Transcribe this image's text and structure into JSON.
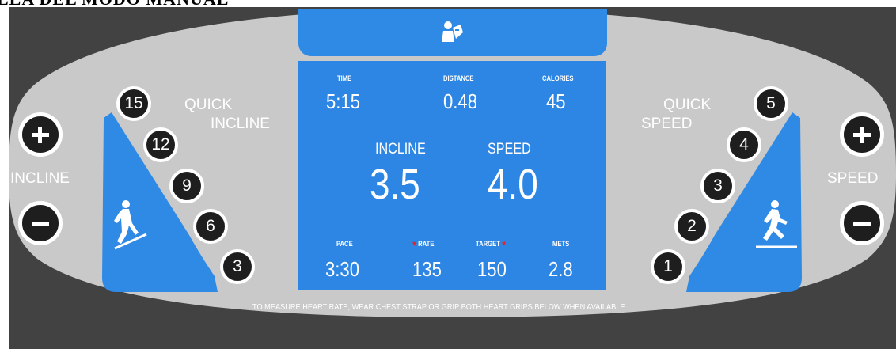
{
  "caption": "LLA DEL MODO MANUAL",
  "incline_controls": {
    "label": "INCLINE",
    "quick_label_1": "QUICK",
    "quick_label_2": "INCLINE",
    "quick_buttons": [
      "15",
      "12",
      "9",
      "6",
      "3"
    ]
  },
  "speed_controls": {
    "label": "SPEED",
    "quick_label_1": "QUICK",
    "quick_label_2": "SPEED",
    "quick_buttons": [
      "5",
      "4",
      "3",
      "2",
      "1"
    ]
  },
  "display": {
    "time": {
      "label": "TIME",
      "value": "5:15"
    },
    "distance": {
      "label": "DISTANCE",
      "value": "0.48"
    },
    "calories": {
      "label": "CALORIES",
      "value": "45"
    },
    "incline": {
      "label": "INCLINE",
      "value": "3.5"
    },
    "speed": {
      "label": "SPEED",
      "value": "4.0"
    },
    "pace": {
      "label": "PACE",
      "value": "3:30"
    },
    "heart_rate": {
      "label": "RATE",
      "value": "135"
    },
    "target": {
      "label": "TARGET",
      "value": "150"
    },
    "mets": {
      "label": "METS",
      "value": "2.8"
    }
  },
  "footnote": "TO MEASURE HEART RATE, WEAR CHEST STRAP OR GRIP BOTH HEART GRIPS BELOW WHEN AVAILABLE",
  "colors": {
    "panel": "#c9c9c9",
    "screen": "#2e86e4",
    "background": "#424242",
    "heart": "#e8242a"
  },
  "icons": [
    "plus-icon",
    "minus-icon",
    "hiker-icon",
    "runner-icon",
    "user-card-icon",
    "heart-icon"
  ]
}
